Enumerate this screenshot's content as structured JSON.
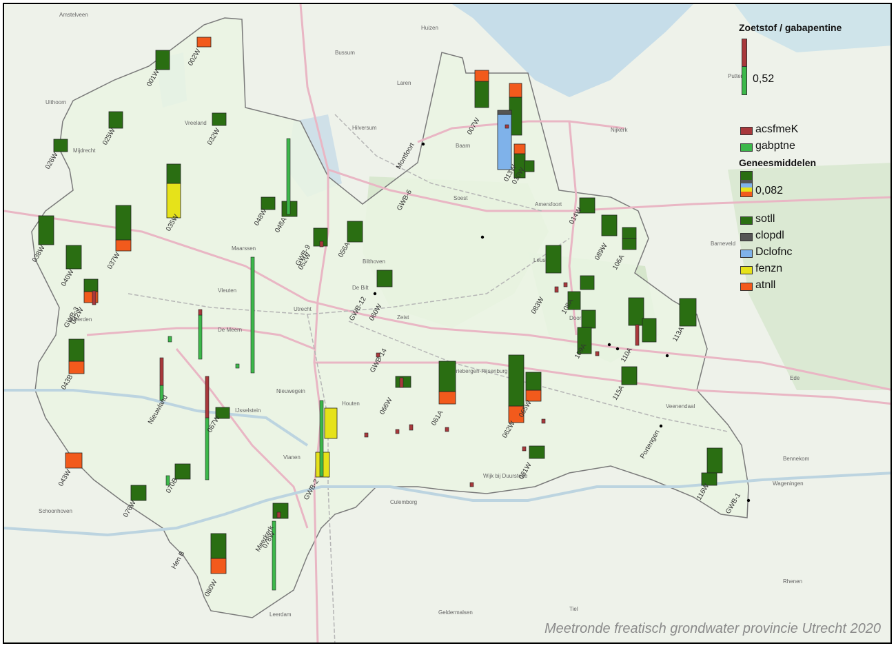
{
  "title": "Meetronde freatisch grondwater provincie Utrecht 2020",
  "colors": {
    "acsfmeK": "#a8383b",
    "gabptne": "#3cb84a",
    "sotll": "#2a6e12",
    "clopdl": "#555555",
    "Dclofnc": "#7fb2ea",
    "fenzn": "#e6e21a",
    "atnll": "#f25a1c"
  },
  "legend": {
    "ratio_title": "Zoetstof / gabapentine",
    "ratio_value": "0,52",
    "ratio_items": [
      {
        "key": "acsfmeK",
        "label": "acsfmeK",
        "color": "#a8383b"
      },
      {
        "key": "gabptne",
        "label": "gabptne",
        "color": "#3cb84a"
      }
    ],
    "med_title": "Geneesmiddelen",
    "med_value": "0,082",
    "med_items": [
      {
        "key": "sotll",
        "label": "sotll",
        "color": "#2a6e12"
      },
      {
        "key": "clopdl",
        "label": "clopdl",
        "color": "#555555"
      },
      {
        "key": "Dclofnc",
        "label": "Dclofnc",
        "color": "#7fb2ea"
      },
      {
        "key": "fenzn",
        "label": "fenzn",
        "color": "#e6e21a"
      },
      {
        "key": "atnll",
        "label": "atnll",
        "color": "#f25a1c"
      }
    ]
  },
  "place_labels": [
    "Amstelveen",
    "Uithoorn",
    "Mijdrecht",
    "Vreeland",
    "Hilversum",
    "Bussum",
    "Huizen",
    "Laren",
    "Baarn",
    "Soest",
    "Amersfoort",
    "Leusden",
    "Nijkerk",
    "Barneveld",
    "Maarssen",
    "Bilthoven",
    "De Bilt",
    "Zeist",
    "Utrecht",
    "Vleuten",
    "De Meern",
    "Woerden",
    "Nieuwegein",
    "IJsselstein",
    "Houten",
    "Vianen",
    "Culemborg",
    "Schoonhoven",
    "Leerdam",
    "Veenendaal",
    "Ede",
    "Wageningen",
    "Wijk bij Duurstede",
    "Rhenen",
    "Driebergen-Rijsenburg",
    "Doorn",
    "Bennekom",
    "Tiel",
    "Geldermalsen",
    "Putten"
  ],
  "stations": [
    "001W",
    "002W",
    "007W",
    "010W",
    "013W",
    "014W",
    "025W",
    "026W",
    "032W",
    "035W",
    "037W",
    "038W",
    "040W",
    "042W",
    "043B",
    "043W",
    "048W",
    "048A",
    "052W",
    "056A",
    "060W",
    "061A",
    "062W",
    "065W",
    "066W",
    "067W",
    "070B",
    "076W",
    "078W",
    "080W",
    "081W",
    "083W",
    "089W",
    "106A",
    "108A",
    "109A",
    "110A",
    "113A",
    "115A",
    "116W",
    "GWB-1",
    "GWB-2",
    "GWB-3",
    "GWB-6",
    "GWB-9",
    "GWB-12",
    "GWB-14",
    "Portengen",
    "Montfoort",
    "Nieuwland",
    "Hen B",
    "Meerkerk"
  ]
}
